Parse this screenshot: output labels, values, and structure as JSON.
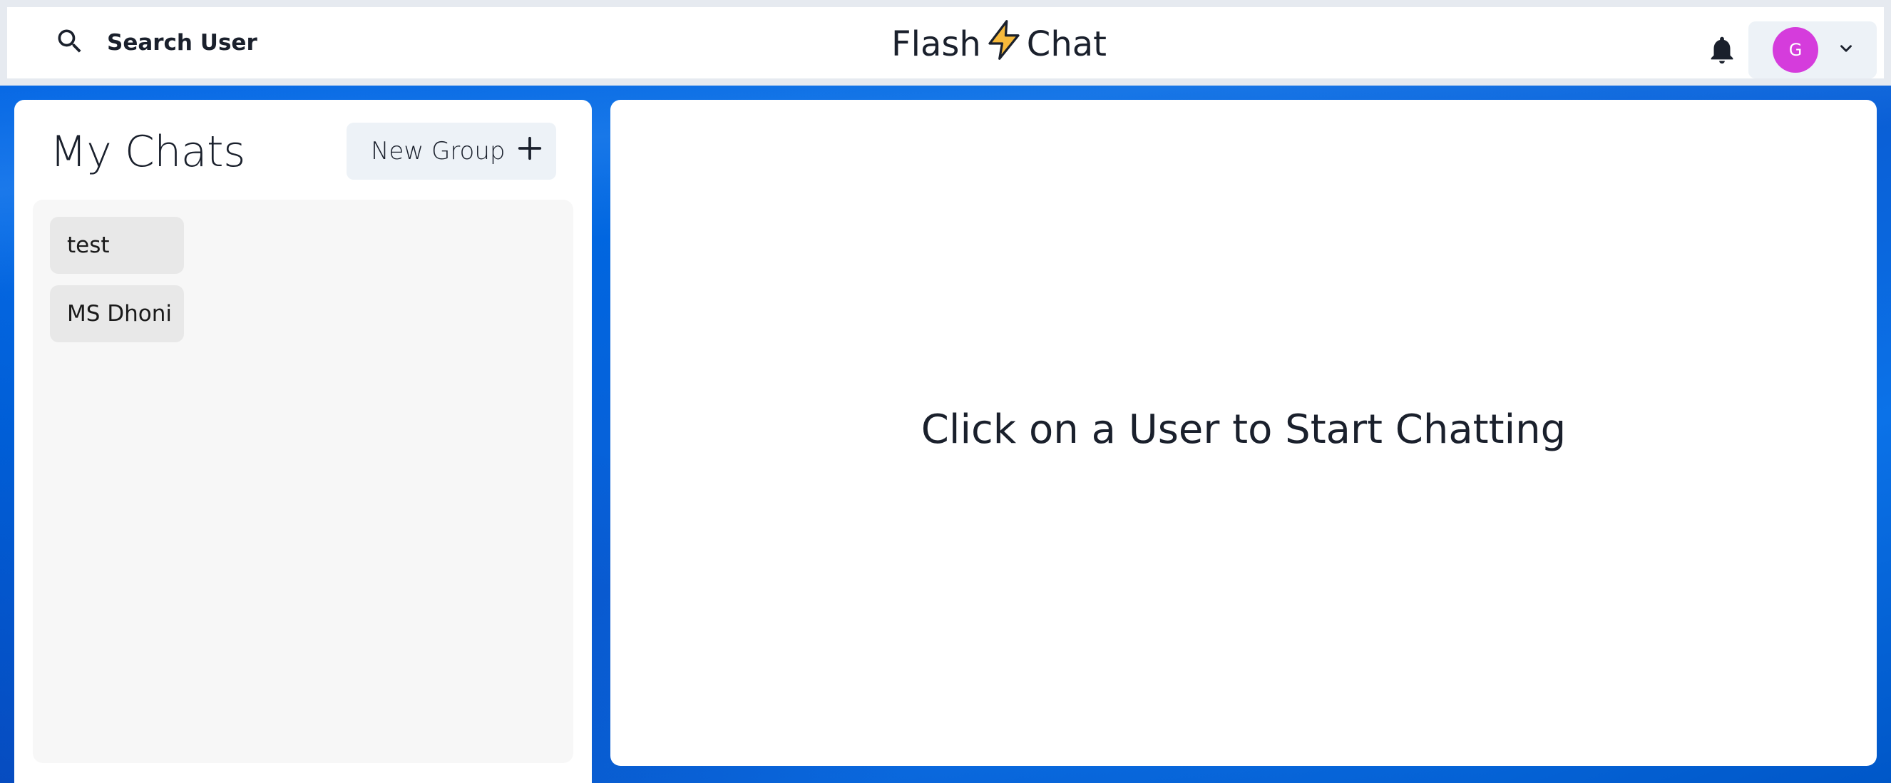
{
  "header": {
    "search_label": "Search User",
    "brand_left": "Flash",
    "brand_right": "Chat",
    "avatar_initial": "G",
    "avatar_color": "#d53cdc"
  },
  "chats": {
    "title": "My Chats",
    "new_group_label": "New Group",
    "items": [
      {
        "label": "test"
      },
      {
        "label": "MS Dhoni"
      }
    ]
  },
  "chat_box": {
    "placeholder": "Click on a User to Start Chatting"
  },
  "icons": {
    "search": "search-icon",
    "lightning": "lightning-icon",
    "bell": "bell-icon",
    "chevron": "chevron-down-icon",
    "plus": "plus-icon"
  },
  "colors": {
    "background": "#0a6ae6",
    "panel": "#ffffff",
    "button": "#edf2f7",
    "lightning": "#f6b93b"
  }
}
